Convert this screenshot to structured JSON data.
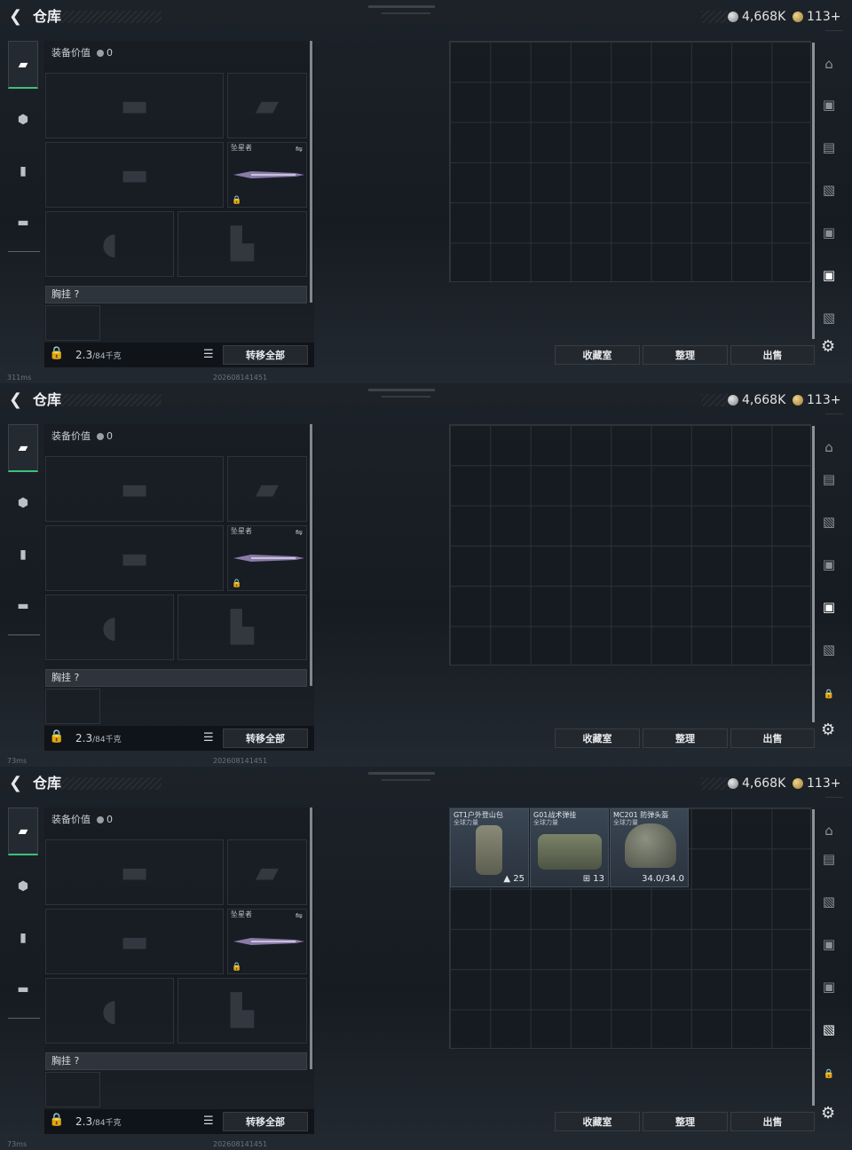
{
  "header": {
    "title": "仓库",
    "silver_amount": "4,668K",
    "gold_amount": "113+"
  },
  "loadout": {
    "value_label": "装备价值",
    "value": "0",
    "melee_label": "坠星者",
    "chest_label": "胸挂 ?",
    "weight_value": "2.3",
    "weight_unit": "/84千克",
    "transfer_all": "转移全部"
  },
  "stash": {
    "fav_button": "收藏室",
    "sort_button": "整理",
    "sell_button": "出售"
  },
  "panels": [
    {
      "ping": "311ms",
      "date": "202608141451"
    },
    {
      "ping": "73ms",
      "date": "202608141451"
    },
    {
      "ping": "73ms",
      "date": "202608141451"
    }
  ],
  "items": [
    {
      "name": "GT1户外登山包",
      "sub": "全球力量",
      "value": "25"
    },
    {
      "name": "G01战术弹挂",
      "sub": "全球力量",
      "value": "13"
    },
    {
      "name": "MC201 防弹头盔",
      "sub": "全球力量",
      "value": "34.0/34.0"
    }
  ],
  "colors": {
    "accent": "#3ec07a",
    "coin_silver": "#c8ccd0",
    "coin_gold": "#d4b06a"
  },
  "icons": [
    "back-arrow-icon",
    "silver-coin-icon",
    "gold-coin-icon",
    "weapon-tab-icon",
    "armor-tab-icon",
    "backpack-tab-icon",
    "toolbox-tab-icon",
    "lock-icon",
    "list-icon",
    "swap-icon",
    "gear-icon"
  ]
}
